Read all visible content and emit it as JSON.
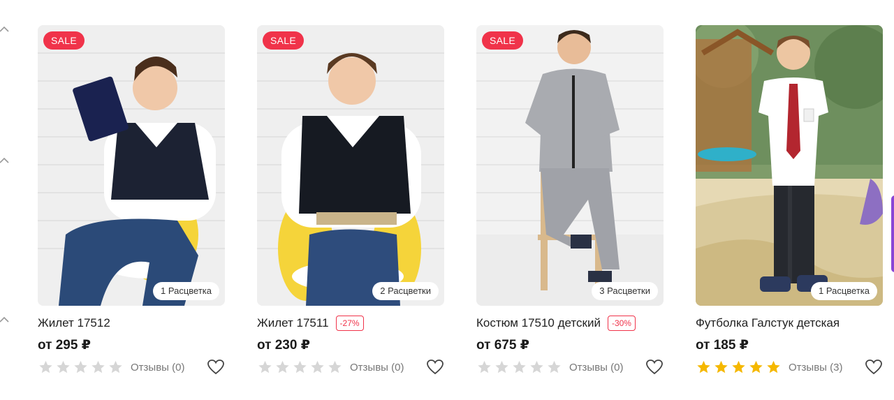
{
  "colors": {
    "sale_badge": "#f0334a",
    "star_empty": "#d6d6d6",
    "star_filled": "#f5b800"
  },
  "nav": {
    "chevrons": [
      "chevron-up-icon",
      "chevron-up-icon",
      "chevron-up-icon"
    ]
  },
  "products": [
    {
      "sale": "SALE",
      "colors_label": "1 Расцветка",
      "title": "Жилет 17512",
      "discount": "",
      "price": "от 295 ₽",
      "rating": 0,
      "reviews": "Отзывы (0)"
    },
    {
      "sale": "SALE",
      "colors_label": "2 Расцветки",
      "title": "Жилет 17511",
      "discount": "-27%",
      "price": "от 230 ₽",
      "rating": 0,
      "reviews": "Отзывы (0)"
    },
    {
      "sale": "SALE",
      "colors_label": "3 Расцветки",
      "title": "Костюм 17510 детский",
      "discount": "-30%",
      "price": "от 675 ₽",
      "rating": 0,
      "reviews": "Отзывы (0)"
    },
    {
      "sale": "",
      "colors_label": "1 Расцветка",
      "title": "Футболка Галстук детская",
      "discount": "",
      "price": "от 185 ₽",
      "rating": 5,
      "reviews": "Отзывы (3)"
    }
  ]
}
